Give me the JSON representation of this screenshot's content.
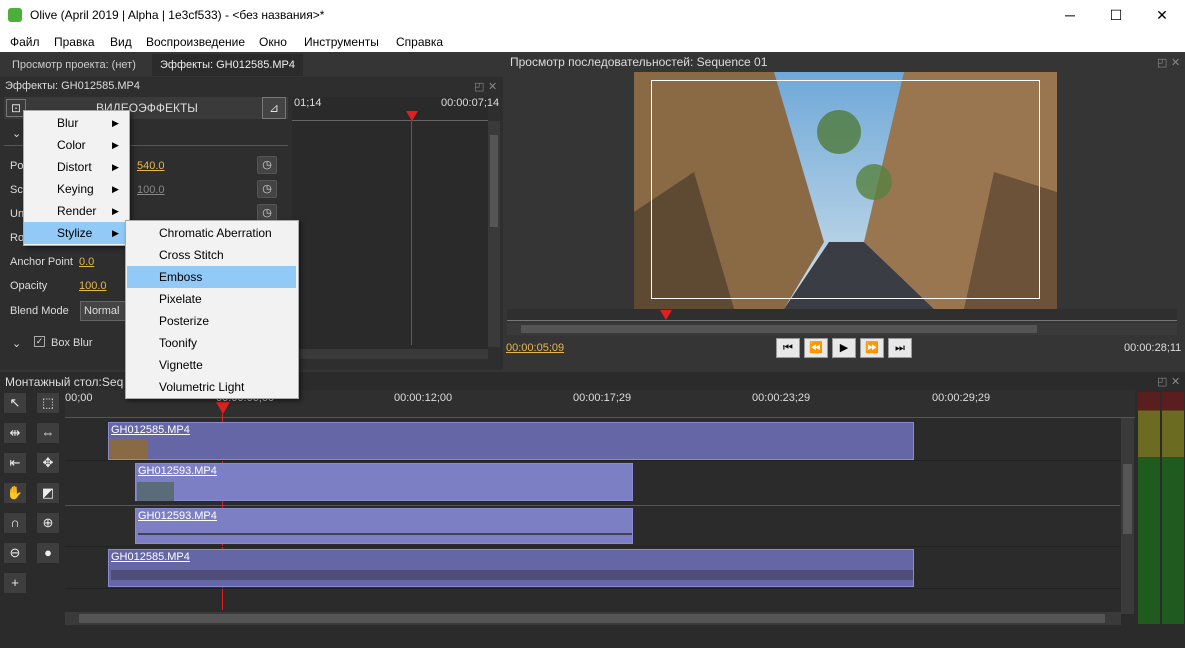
{
  "window": {
    "title": "Olive (April 2019 | Alpha | 1e3cf533) - <без названия>*",
    "minimize": "─",
    "maximize": "☐",
    "close": "✕"
  },
  "menu": [
    "Файл",
    "Правка",
    "Вид",
    "Воспроизведение",
    "Окно",
    "Инструменты",
    "Справка"
  ],
  "left_tabs": [
    "Просмотр проекта: (нет)",
    "Эффекты: GH012585.MP4"
  ],
  "effects": {
    "header": "Эффекты: GH012585.MP4",
    "section": "ВИДЕОЭФФЕКТЫ",
    "tc_start": "01;14",
    "tc_end": "00:00:07;14",
    "rows": [
      {
        "label": "Po",
        "value": "540.0",
        "style": "link"
      },
      {
        "label": "Sc",
        "value": "100.0",
        "style": "gray"
      },
      {
        "label": "Un",
        "value": "",
        "style": "none"
      },
      {
        "label": "Ro",
        "value": "",
        "style": "none"
      },
      {
        "label": "Anchor Point",
        "value": "0.0",
        "style": "link"
      },
      {
        "label": "Opacity",
        "value": "100.0",
        "style": "link"
      },
      {
        "label": "Blend Mode",
        "value": "Normal",
        "style": "select"
      }
    ],
    "box_blur": "Box Blur"
  },
  "context_menu": {
    "items": [
      "Blur",
      "Color",
      "Distort",
      "Keying",
      "Render",
      "Stylize"
    ],
    "highlighted": "Stylize"
  },
  "submenu": {
    "items": [
      "Chromatic Aberration",
      "Cross Stitch",
      "Emboss",
      "Pixelate",
      "Posterize",
      "Toonify",
      "Vignette",
      "Volumetric Light"
    ],
    "highlighted": "Emboss"
  },
  "viewer": {
    "title": "Просмотр последовательностей: Sequence 01",
    "current_tc": "00:00:05;09",
    "end_tc": "00:00:28;11",
    "controls": [
      "⏮",
      "⏪",
      "▶",
      "⏩",
      "⏭"
    ]
  },
  "timeline": {
    "title": "Монтажный стол:Seq",
    "ticks": [
      "00;00",
      "00:00:06;00",
      "00:00:12;00",
      "00:00:17;29",
      "00:00:23;29",
      "00:00:29;29"
    ],
    "clips": [
      {
        "name": "GH012585.MP4",
        "track": "v2"
      },
      {
        "name": "GH012593.MP4",
        "track": "v1"
      },
      {
        "name": "GH012593.MP4",
        "track": "a1"
      },
      {
        "name": "GH012585.MP4",
        "track": "a2"
      }
    ]
  },
  "tools": [
    "↖",
    "⬚",
    "⇹",
    "⇔",
    "⇤",
    "✥",
    "✋",
    "◩",
    "∩",
    "⊕",
    "⊖",
    "●",
    "+"
  ],
  "colors": {
    "accent": "#e6b84a",
    "playhead": "#e02020",
    "clip": "#6566a6",
    "clip_light": "#7d7fc4",
    "highlight": "#91c9f7"
  }
}
